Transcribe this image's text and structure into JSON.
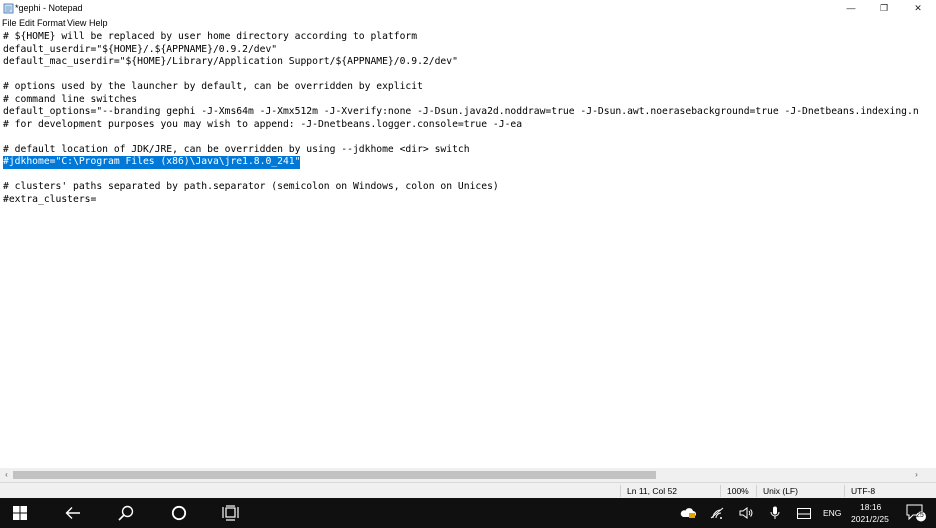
{
  "window": {
    "title": "*gephi - Notepad",
    "minimize_glyph": "—",
    "maximize_glyph": "❐",
    "close_glyph": "✕"
  },
  "menu": {
    "items": [
      {
        "label": "File"
      },
      {
        "label": "Edit"
      },
      {
        "label": "Format"
      },
      {
        "label": "View"
      },
      {
        "label": "Help"
      }
    ]
  },
  "editor": {
    "lines": [
      {
        "text": "# ${HOME} will be replaced by user home directory according to platform",
        "selected": false
      },
      {
        "text": "default_userdir=\"${HOME}/.${APPNAME}/0.9.2/dev\"",
        "selected": false
      },
      {
        "text": "default_mac_userdir=\"${HOME}/Library/Application Support/${APPNAME}/0.9.2/dev\"",
        "selected": false
      },
      {
        "text": "",
        "selected": false
      },
      {
        "text": "# options used by the launcher by default, can be overridden by explicit",
        "selected": false
      },
      {
        "text": "# command line switches",
        "selected": false
      },
      {
        "text": "default_options=\"--branding gephi -J-Xms64m -J-Xmx512m -J-Xverify:none -J-Dsun.java2d.noddraw=true -J-Dsun.awt.noerasebackground=true -J-Dnetbeans.indexing.n",
        "selected": false
      },
      {
        "text": "# for development purposes you may wish to append: -J-Dnetbeans.logger.console=true -J-ea",
        "selected": false
      },
      {
        "text": "",
        "selected": false
      },
      {
        "text": "# default location of JDK/JRE, can be overridden by using --jdkhome <dir> switch",
        "selected": false
      },
      {
        "text": "#jdkhome=\"C:\\Program Files (x86)\\Java\\jre1.8.0_241\"",
        "selected": true
      },
      {
        "text": "",
        "selected": false
      },
      {
        "text": "# clusters' paths separated by path.separator (semicolon on Windows, colon on Unices)",
        "selected": false
      },
      {
        "text": "#extra_clusters=",
        "selected": false
      }
    ],
    "selection_color": "#0078d7"
  },
  "scrollbar": {
    "left_arrow": "‹",
    "right_arrow": "›"
  },
  "status": {
    "position": "Ln 11, Col 52",
    "zoom": "100%",
    "line_ending": "Unix (LF)",
    "encoding": "UTF-8"
  },
  "taskbar": {
    "icons": [
      "windows-start-icon",
      "back-arrow-icon",
      "search-icon",
      "cortana-circle-icon",
      "task-view-icon"
    ],
    "tray_icons": [
      "onedrive-icon",
      "wifi-icon",
      "volume-icon",
      "microphone-icon",
      "keyboard-icon"
    ],
    "language": "ENG",
    "time": "18:16",
    "date": "2021/2/25",
    "notification_count": "25"
  }
}
